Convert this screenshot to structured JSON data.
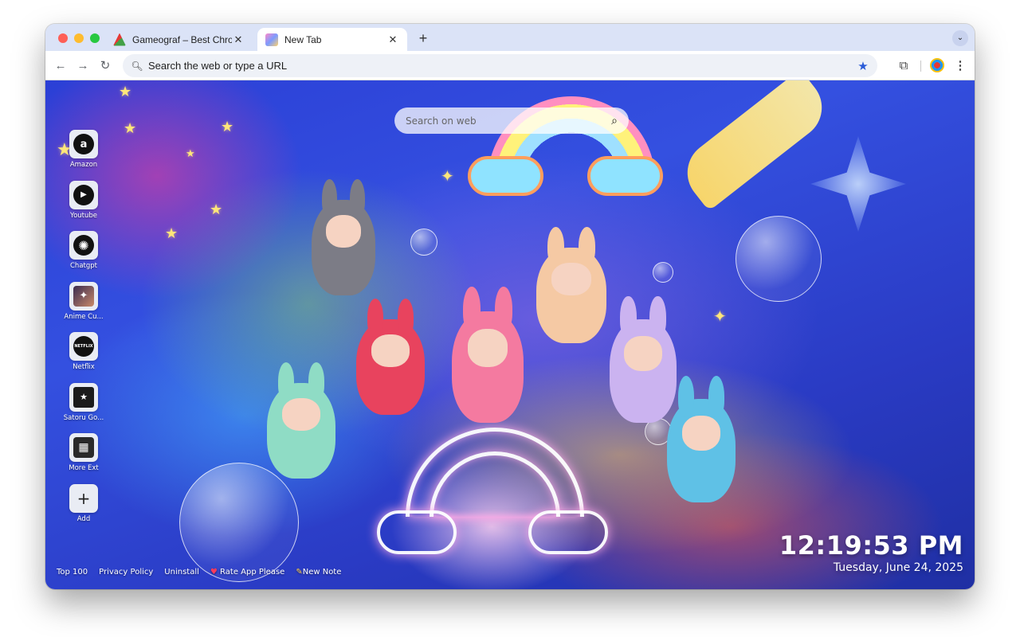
{
  "tabs": [
    {
      "title": "Gameograf – Best Chrome Li",
      "active": false
    },
    {
      "title": "New Tab",
      "active": true
    }
  ],
  "omnibox": {
    "placeholder": "Search the web or type a URL"
  },
  "search": {
    "placeholder": "Search on web"
  },
  "shortcuts": [
    {
      "label": "Amazon",
      "icon": "amazon-icon",
      "glyph": "a"
    },
    {
      "label": "Youtube",
      "icon": "youtube-icon",
      "glyph": "▶"
    },
    {
      "label": "Chatgpt",
      "icon": "chatgpt-icon",
      "glyph": "✺"
    },
    {
      "label": "Anime Cu...",
      "icon": "anime-cursor-icon",
      "glyph": "✦"
    },
    {
      "label": "Netflix",
      "icon": "netflix-icon",
      "glyph": "NETFLIX"
    },
    {
      "label": "Satoru Go...",
      "icon": "satoru-gojo-icon",
      "glyph": "★"
    },
    {
      "label": "More Ext",
      "icon": "more-extensions-icon",
      "glyph": "▦"
    },
    {
      "label": "Add",
      "icon": "add-icon",
      "glyph": "+"
    }
  ],
  "footer": {
    "links": [
      "Top 100",
      "Privacy Policy",
      "Uninstall",
      "Rate App Please",
      "New Note"
    ]
  },
  "clock": {
    "time": "12:19:53 PM",
    "date": "Tuesday, June 24, 2025"
  },
  "colors": {
    "tabstrip": "#dbe3f7",
    "accent_star": "#2a5bd7",
    "background_blue": "#2b3fd6"
  }
}
